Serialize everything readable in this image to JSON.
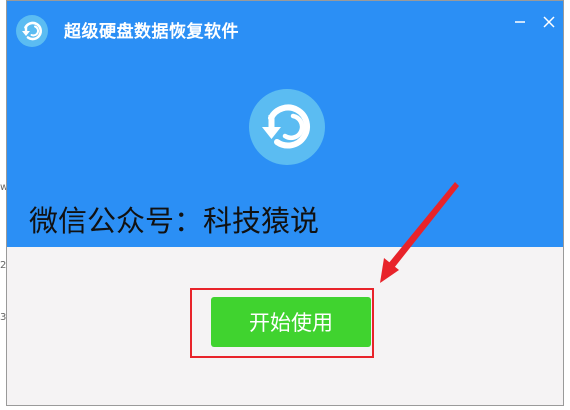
{
  "window": {
    "title": "超级硬盘数据恢复软件",
    "app_icon": "recovery-logo-icon",
    "minimize_icon": "minimize-icon",
    "close_icon": "close-icon"
  },
  "header": {
    "promo_text": "微信公众号：科技猿说",
    "logo_icon": "recovery-logo-icon"
  },
  "actions": {
    "start_label": "开始使用"
  },
  "background_fragments": [
    "w",
    "2",
    "3"
  ],
  "colors": {
    "header_blue": "#2b8ff5",
    "logo_circle": "#5bbcf2",
    "body_bg": "#f5f3f4",
    "start_green": "#40d32f",
    "annotation_red": "#e8232a"
  }
}
